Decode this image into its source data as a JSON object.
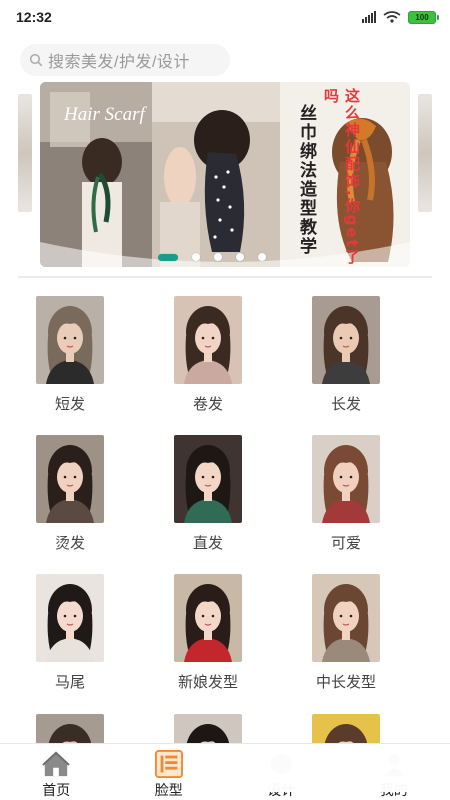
{
  "status_bar": {
    "time": "12:32",
    "battery": "100"
  },
  "search": {
    "placeholder": "搜索美发/护发/设计"
  },
  "banner": {
    "script_text": "Hair Scarf",
    "main_text": "丝巾绑法造型教学",
    "accent_text": "这么神仙配饰,你get了吗",
    "slide_count": 5,
    "active_slide": 1
  },
  "categories": [
    {
      "label": "短发",
      "hair": "#7a6a5c",
      "bg": "#b9b1a8",
      "skin": "#e9cdb8",
      "cloth": "#2b2b2b"
    },
    {
      "label": "卷发",
      "hair": "#3b2a22",
      "bg": "#d7c2b5",
      "skin": "#f1d4c5",
      "cloth": "#c9a9a0"
    },
    {
      "label": "长发",
      "hair": "#4a3528",
      "bg": "#a89c92",
      "skin": "#ebcab4",
      "cloth": "#3d3d3d"
    },
    {
      "label": "烫发",
      "hair": "#2a1f1a",
      "bg": "#9e9186",
      "skin": "#efd2c0",
      "cloth": "#5a4a42"
    },
    {
      "label": "直发",
      "hair": "#1e1815",
      "bg": "#3f3430",
      "skin": "#f2d6c6",
      "cloth": "#2f6b55"
    },
    {
      "label": "可爱",
      "hair": "#7b4a35",
      "bg": "#d9cfc6",
      "skin": "#f0d0bf",
      "cloth": "#a33a3a"
    },
    {
      "label": "马尾",
      "hair": "#1f1a18",
      "bg": "#e9e4df",
      "skin": "#f4dbcd",
      "cloth": "#e8e2dc"
    },
    {
      "label": "新娘发型",
      "hair": "#2a1c18",
      "bg": "#c8b9a6",
      "skin": "#f3d7c8",
      "cloth": "#c3262c"
    },
    {
      "label": "中长发型",
      "hair": "#6b4632",
      "bg": "#d6c7b8",
      "skin": "#f1d1bf",
      "cloth": "#9a8a7c"
    },
    {
      "label": "",
      "hair": "#3a2d26",
      "bg": "#a69b90",
      "skin": "#e6c8b5",
      "cloth": "#3a3a3a"
    },
    {
      "label": "",
      "hair": "#1c1714",
      "bg": "#cfc7bf",
      "skin": "#efd3c3",
      "cloth": "#333"
    },
    {
      "label": "",
      "hair": "#5a3c2c",
      "bg": "#e6c24a",
      "skin": "#f0d2c0",
      "cloth": "#e6c24a"
    }
  ],
  "bottom_nav": [
    {
      "label": "首页",
      "icon": "home-icon"
    },
    {
      "label": "脸型",
      "icon": "face-shape-icon"
    },
    {
      "label": "设计",
      "icon": "design-icon"
    },
    {
      "label": "我的",
      "icon": "profile-icon"
    }
  ],
  "colors": {
    "accent": "#1b9a8f",
    "banner_red": "#e23a3a",
    "nav_icon_active": "#f08a2c"
  }
}
